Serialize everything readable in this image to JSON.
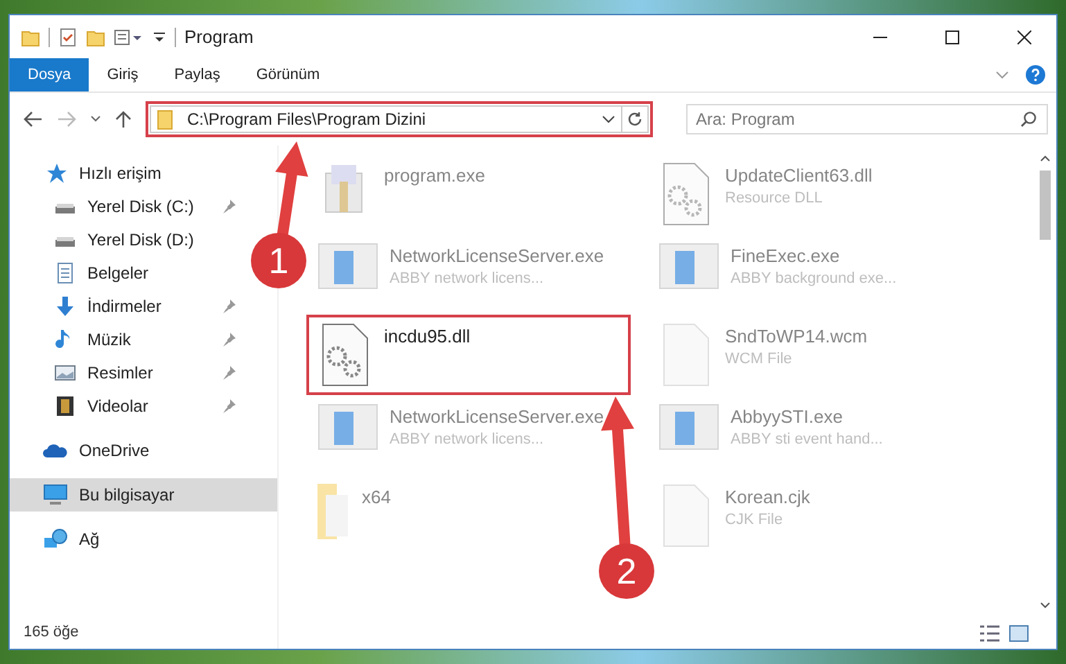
{
  "window": {
    "title": "Program"
  },
  "ribbon_tabs": [
    {
      "label": "Dosya",
      "selected": true
    },
    {
      "label": "Giriş",
      "selected": false
    },
    {
      "label": "Paylaş",
      "selected": false
    },
    {
      "label": "Görünüm",
      "selected": false
    }
  ],
  "address": {
    "path": "C:\\Program Files\\Program Dizini",
    "highlighted": true
  },
  "search": {
    "placeholder": "Ara: Program"
  },
  "sidebar": {
    "items": [
      {
        "label": "Hızlı erişim",
        "kind": "star",
        "pinned": false,
        "selected": false,
        "children": [
          {
            "label": "Yerel Disk (C:)",
            "kind": "drive",
            "pinned": true,
            "selected": false
          },
          {
            "label": "Yerel Disk (D:)",
            "kind": "drive",
            "pinned": false,
            "selected": false
          },
          {
            "label": "Belgeler",
            "kind": "docs",
            "pinned": false,
            "selected": false
          },
          {
            "label": "İndirmeler",
            "kind": "download",
            "pinned": true,
            "selected": false
          },
          {
            "label": "Müzik",
            "kind": "music",
            "pinned": true,
            "selected": false
          },
          {
            "label": "Resimler",
            "kind": "pictures",
            "pinned": true,
            "selected": false
          },
          {
            "label": "Videolar",
            "kind": "video",
            "pinned": true,
            "selected": false
          }
        ]
      },
      {
        "label": "OneDrive",
        "kind": "cloud",
        "pinned": false,
        "selected": false
      },
      {
        "label": "Bu bilgisayar",
        "kind": "pc",
        "pinned": false,
        "selected": true
      },
      {
        "label": "Ağ",
        "kind": "network",
        "pinned": false,
        "selected": false
      }
    ]
  },
  "files": [
    {
      "name": "program.exe",
      "kind": "setup",
      "highlighted": false
    },
    {
      "name": "UpdateClient63.dll",
      "description": "Resource DLL",
      "kind": "dll",
      "highlighted": false
    },
    {
      "name": "NetworkLicenseServer.exe",
      "description": "ABBY network licens...",
      "kind": "exe",
      "highlighted": false
    },
    {
      "name": "FineExec.exe",
      "description": "ABBY background exe...",
      "kind": "exe",
      "highlighted": false
    },
    {
      "name": "incdu95.dll",
      "kind": "dll",
      "highlighted": true
    },
    {
      "name": "SndToWP14.wcm",
      "description": "WCM File",
      "kind": "doc",
      "highlighted": false
    },
    {
      "name": "NetworkLicenseServer.exe",
      "description": "ABBY network licens...",
      "kind": "exe",
      "highlighted": false
    },
    {
      "name": "AbbyySTI.exe",
      "description": "ABBY sti event hand...",
      "kind": "exe",
      "highlighted": false
    },
    {
      "name": "x64",
      "kind": "folder",
      "highlighted": false
    },
    {
      "name": "Korean.cjk",
      "description": "CJK File",
      "kind": "doc",
      "highlighted": false
    }
  ],
  "status_bar": {
    "count": "165 öğe"
  },
  "callouts": [
    {
      "number": "1"
    },
    {
      "number": "2"
    }
  ]
}
